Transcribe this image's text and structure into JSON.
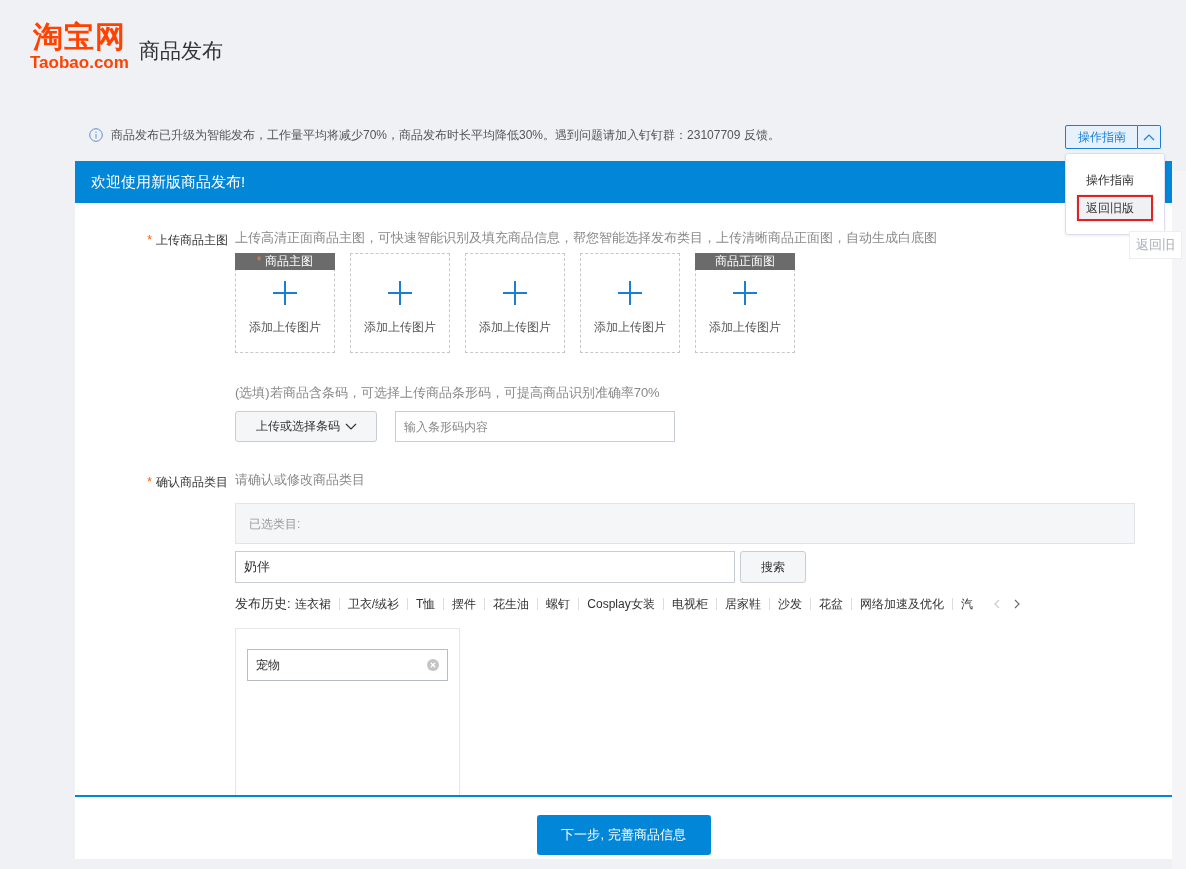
{
  "header": {
    "logo_text": "淘宝网",
    "logo_domain": "Taobao.com",
    "title": "商品发布"
  },
  "notice": {
    "text": "商品发布已升级为智能发布，工作量平均将减少70%，商品发布时长平均降低30%。遇到问题请加入钉钉群：23107709 反馈。",
    "guide_button": "操作指南",
    "expanded": true
  },
  "dropdown": {
    "items": [
      {
        "label": "操作指南",
        "selected": false
      },
      {
        "label": "返回旧版",
        "selected": true
      }
    ]
  },
  "ghost_label": "返回旧",
  "card": {
    "title": "欢迎使用新版商品发布!"
  },
  "main_image": {
    "label": "上传商品主图",
    "required_mark": "*",
    "hint": "上传高清正面商品主图，可快速智能识别及填充商品信息，帮您智能选择发布类目，上传清晰商品正面图，自动生成白底图",
    "slots": [
      {
        "tag": "商品主图",
        "tag_mark": "*",
        "text": "添加上传图片"
      },
      {
        "text": "添加上传图片"
      },
      {
        "text": "添加上传图片"
      },
      {
        "text": "添加上传图片"
      },
      {
        "tag": "商品正面图",
        "text": "添加上传图片"
      }
    ]
  },
  "barcode": {
    "hint": "(选填)若商品含条码，可选择上传商品条形码，可提高商品识别准确率70%",
    "button": "上传或选择条码",
    "placeholder": "输入条形码内容"
  },
  "category": {
    "label": "确认商品类目",
    "required_mark": "*",
    "hint": "请确认或修改商品类目",
    "selected_label": "已选类目:",
    "search_value": "奶伴",
    "search_button": "搜索",
    "history_label": "发布历史:",
    "history": [
      "连衣裙",
      "卫衣/绒衫",
      "T恤",
      "摆件",
      "花生油",
      "螺钉",
      "Cosplay女装",
      "电视柜",
      "居家鞋",
      "沙发",
      "花盆",
      "网络加速及优化",
      "汽"
    ],
    "filter_value": "宠物"
  },
  "footer": {
    "next_button": "下一步, 完善商品信息"
  }
}
